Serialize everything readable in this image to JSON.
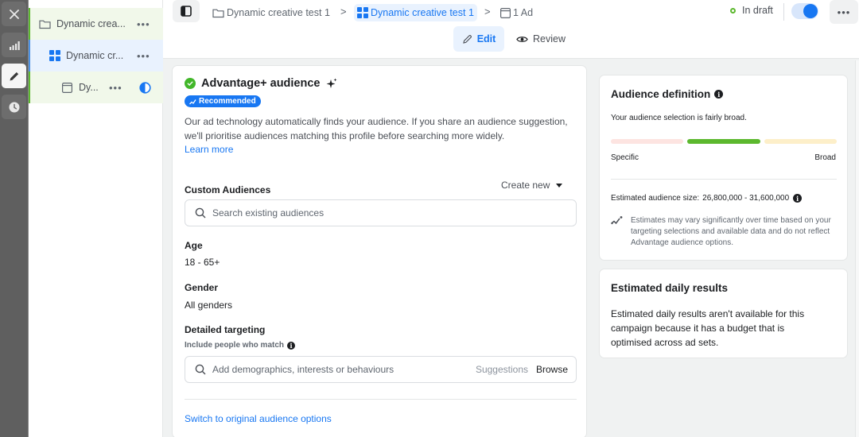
{
  "rail": {
    "buttons": [
      {
        "name": "close",
        "icon": "close-icon"
      },
      {
        "name": "insights",
        "icon": "bar-chart-icon"
      },
      {
        "name": "edit",
        "icon": "pencil-icon",
        "active": true
      },
      {
        "name": "history",
        "icon": "clock-icon"
      }
    ]
  },
  "tree": {
    "items": [
      {
        "label": "Dynamic crea...",
        "level": "campaign",
        "icon": "folder-icon",
        "more": "•••"
      },
      {
        "label": "Dynamic cr...",
        "level": "ad-set",
        "icon": "grid-icon",
        "more": "•••"
      },
      {
        "label": "Dy...",
        "level": "ad",
        "icon": "ad-icon",
        "more": "•••",
        "status_icon": "half-circle-icon"
      }
    ]
  },
  "topbar": {
    "breadcrumbs": [
      {
        "label": "Dynamic creative test 1",
        "icon": "folder-icon"
      },
      {
        "label": "Dynamic creative test 1",
        "icon": "grid-icon",
        "active": true
      },
      {
        "label": "1 Ad",
        "icon": "ad-icon"
      }
    ],
    "separator": ">",
    "status": "In draft",
    "toggle_on": true,
    "more": "•••",
    "modes": {
      "edit": "Edit",
      "review": "Review"
    }
  },
  "main": {
    "title": "Advantage+ audience",
    "badge": "Recommended",
    "description": "Our ad technology automatically finds your audience. If you share an audience suggestion, we'll prioritise audiences matching this profile before searching more widely.",
    "learn_more": "Learn more",
    "custom_audiences": {
      "label": "Custom Audiences",
      "create_new": "Create new",
      "placeholder": "Search existing audiences"
    },
    "age": {
      "label": "Age",
      "value": "18 - 65+"
    },
    "gender": {
      "label": "Gender",
      "value": "All genders"
    },
    "detailed_targeting": {
      "label": "Detailed targeting",
      "sub_label": "Include people who match",
      "placeholder": "Add demographics, interests or behaviours",
      "suggestions": "Suggestions",
      "browse": "Browse"
    },
    "switch_link": "Switch to original audience options"
  },
  "audience_definition": {
    "title": "Audience definition",
    "summary": "Your audience selection is fairly broad.",
    "meter_position": "middle",
    "colors": {
      "specific": "#fde4e1",
      "middle": "#5cb82e",
      "broad": "#fdefc9"
    },
    "left_label": "Specific",
    "right_label": "Broad",
    "estimated_size_label": "Estimated audience size:",
    "estimated_size": "26,800,000 - 31,600,000",
    "note": "Estimates may vary significantly over time based on your targeting selections and available data and do not reflect Advantage audience options."
  },
  "daily_results": {
    "title": "Estimated daily results",
    "text": "Estimated daily results aren't available for this campaign because it has a budget that is optimised across ad sets."
  }
}
